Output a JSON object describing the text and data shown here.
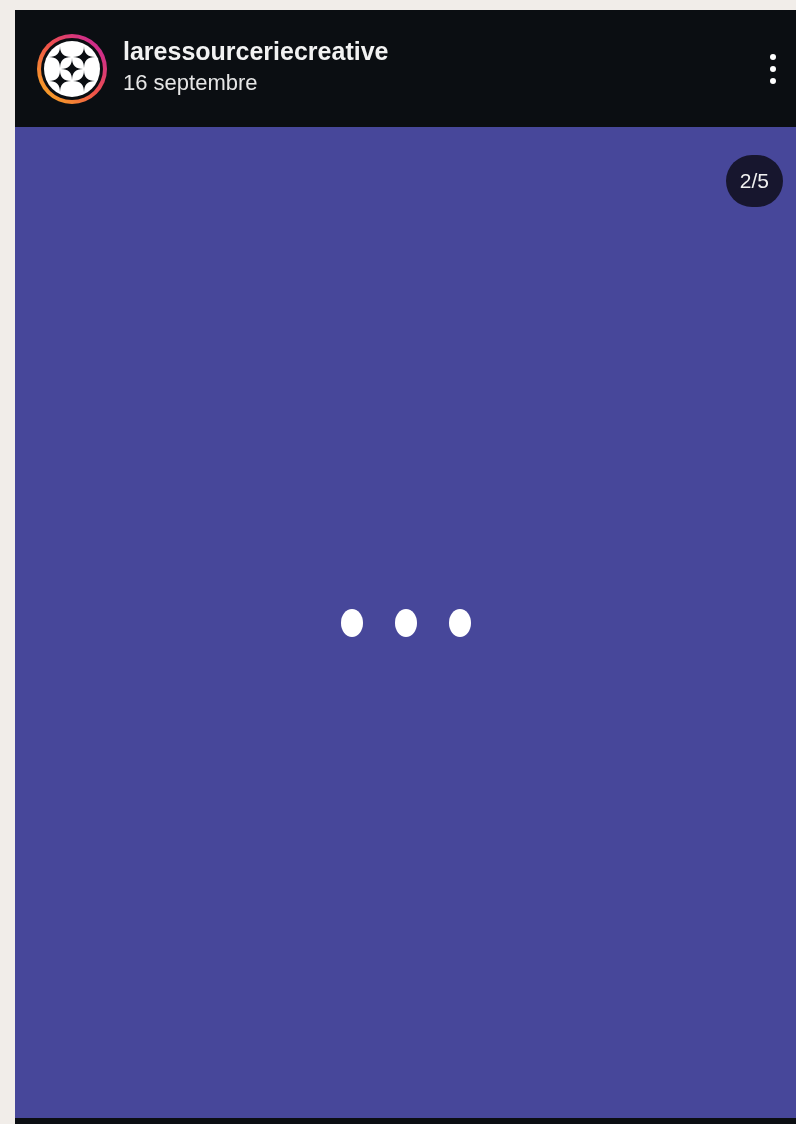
{
  "post": {
    "username": "laressourceriecreative",
    "date": "16 septembre",
    "slide_counter": "2/5"
  }
}
